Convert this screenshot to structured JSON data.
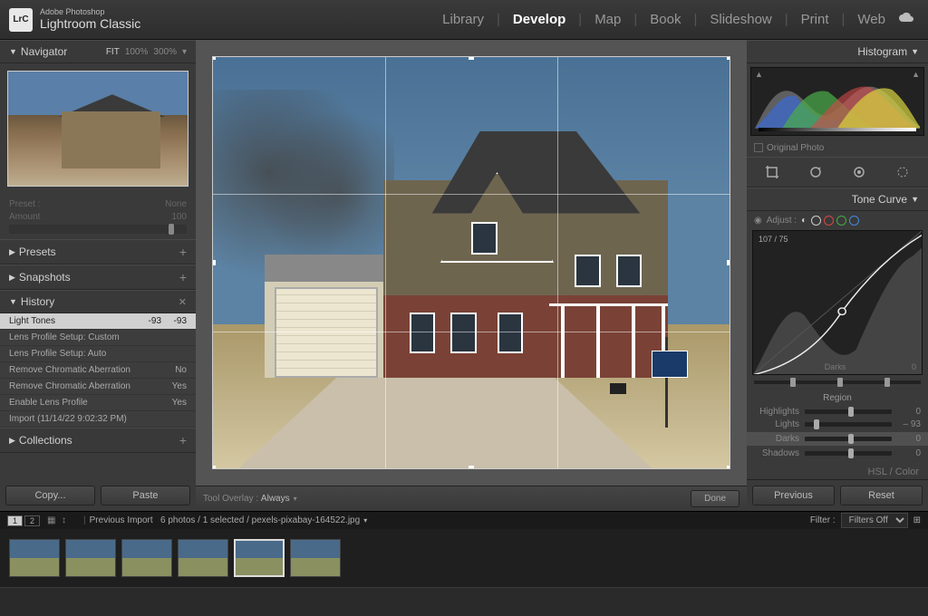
{
  "app": {
    "brand_top": "Adobe Photoshop",
    "brand_bottom": "Lightroom Classic",
    "logo": "LrC"
  },
  "modules": {
    "items": [
      "Library",
      "Develop",
      "Map",
      "Book",
      "Slideshow",
      "Print",
      "Web"
    ],
    "active": "Develop"
  },
  "navigator": {
    "title": "Navigator",
    "zoom": {
      "fit": "FIT",
      "fill": "100%",
      "other": "300%"
    }
  },
  "preset_block": {
    "preset_label": "Preset :",
    "preset_value": "None",
    "amount_label": "Amount",
    "amount_value": "100"
  },
  "presets": {
    "title": "Presets"
  },
  "snapshots": {
    "title": "Snapshots"
  },
  "history": {
    "title": "History",
    "items": [
      {
        "name": "Light Tones",
        "v1": "-93",
        "v2": "-93",
        "sel": true
      },
      {
        "name": "Lens Profile Setup: Custom",
        "v1": "",
        "v2": ""
      },
      {
        "name": "Lens Profile Setup: Auto",
        "v1": "",
        "v2": ""
      },
      {
        "name": "Remove Chromatic Aberration",
        "v1": "",
        "v2": "No"
      },
      {
        "name": "Remove Chromatic Aberration",
        "v1": "",
        "v2": "Yes"
      },
      {
        "name": "Enable Lens Profile",
        "v1": "",
        "v2": "Yes"
      },
      {
        "name": "Import (11/14/22 9:02:32 PM)",
        "v1": "",
        "v2": ""
      }
    ]
  },
  "collections": {
    "title": "Collections"
  },
  "left_buttons": {
    "copy": "Copy...",
    "paste": "Paste"
  },
  "center": {
    "tool_overlay_label": "Tool Overlay :",
    "tool_overlay_value": "Always",
    "done": "Done"
  },
  "histogram_panel": {
    "title": "Histogram",
    "original": "Original Photo"
  },
  "tone_curve": {
    "title": "Tone Curve",
    "adjust_label": "Adjust :",
    "readout": "107 / 75",
    "bottom_label": "Darks",
    "bottom_val": "0"
  },
  "region": {
    "title": "Region",
    "rows": [
      {
        "label": "Highlights",
        "val": "0",
        "pos": 50
      },
      {
        "label": "Lights",
        "val": "– 93",
        "pos": 10
      },
      {
        "label": "Darks",
        "val": "0",
        "pos": 50,
        "sel": true
      },
      {
        "label": "Shadows",
        "val": "0",
        "pos": 50
      }
    ]
  },
  "hsl": {
    "title": "HSL / Color"
  },
  "right_buttons": {
    "previous": "Previous",
    "reset": "Reset"
  },
  "filmstrip": {
    "pages": [
      "1",
      "2"
    ],
    "source": "Previous Import",
    "count": "6 photos / 1 selected",
    "path": "/ pexels-pixabay-164522.jpg",
    "filter_label": "Filter :",
    "filter_value": "Filters Off",
    "thumbs": 6,
    "selected": 4
  }
}
